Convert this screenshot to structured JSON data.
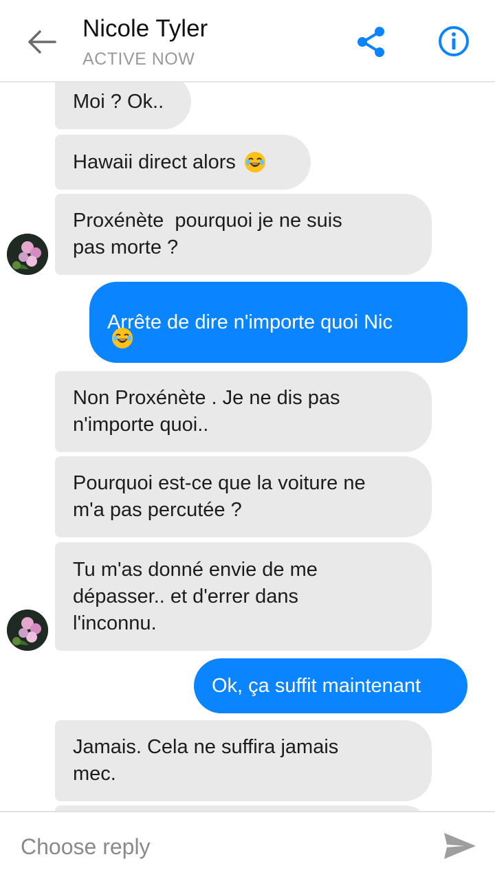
{
  "header": {
    "contact_name": "Nicole Tyler",
    "status": "ACTIVE NOW"
  },
  "colors": {
    "accent": "#0a84ff",
    "incoming_bubble": "#e9e9e9"
  },
  "icons": {
    "back": "arrow-left-icon",
    "share": "share-icon",
    "info": "info-icon",
    "send": "send-icon",
    "emoji": "face-with-tears-of-joy"
  },
  "messages": [
    {
      "dir": "in",
      "text": "Moi ? Ok..",
      "emoji": false
    },
    {
      "dir": "in",
      "text": "Hawaii direct alors ",
      "emoji": true
    },
    {
      "dir": "in",
      "text": "Proxénète  pourquoi je ne suis\npas morte ?",
      "emoji": false
    },
    {
      "dir": "out",
      "text": "Arrête de dire n'importe quoi Nic\n",
      "emoji": true
    },
    {
      "dir": "in",
      "text": "Non Proxénète . Je ne dis pas\nn'importe quoi..",
      "emoji": false
    },
    {
      "dir": "in",
      "text": "Pourquoi est-ce que la voiture ne\nm'a pas percutée ?",
      "emoji": false
    },
    {
      "dir": "in",
      "text": "Tu m'as donné envie de me\ndépasser.. et d'errer dans\nl'inconnu.",
      "emoji": false
    },
    {
      "dir": "out",
      "text": "Ok, ça suffit maintenant",
      "emoji": false
    },
    {
      "dir": "in",
      "text": "Jamais. Cela ne suffira jamais\nmec.",
      "emoji": false
    },
    {
      "dir": "in",
      "text": "",
      "emoji": false
    }
  ],
  "reply": {
    "placeholder": "Choose reply"
  }
}
